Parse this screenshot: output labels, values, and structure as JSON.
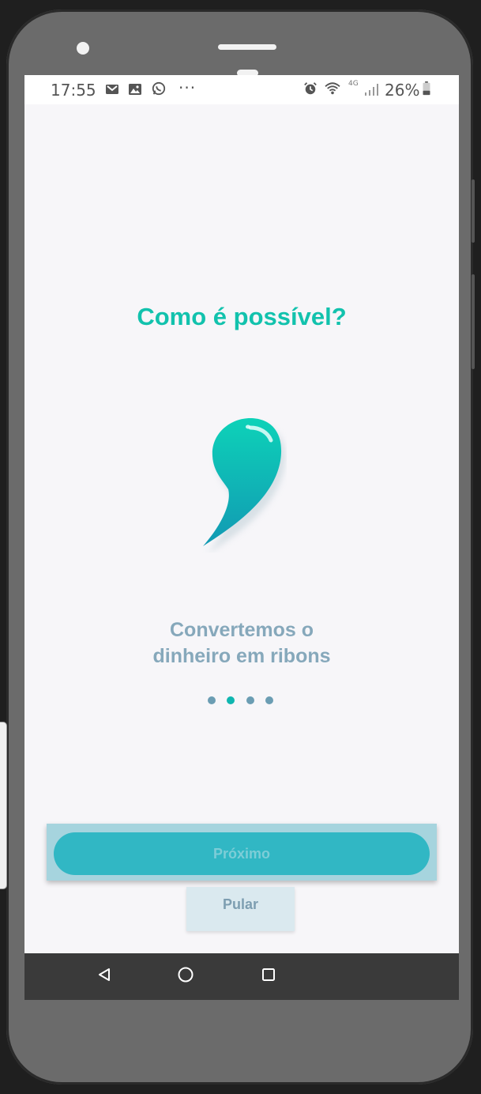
{
  "status_bar": {
    "time": "17:55",
    "notification_icons": [
      "gmail-icon",
      "gallery-icon",
      "whatsapp-icon"
    ],
    "more": "···",
    "system_icons": [
      "alarm-icon",
      "wifi-icon",
      "4g-icon",
      "signal-icon"
    ],
    "network": "4G",
    "battery": "26%"
  },
  "onboarding": {
    "title": "Como é possível?",
    "illustration": "ribon-drop-icon",
    "description_line1": "Convertemos o",
    "description_line2": "dinheiro em ribons",
    "page_count": 4,
    "current_page": 2
  },
  "actions": {
    "next_label": "Próximo",
    "skip_label": "Pular"
  },
  "navigation": [
    "back-icon",
    "home-icon",
    "recents-icon"
  ],
  "colors": {
    "accent": "#12c2ad",
    "button": "#31b7c4",
    "text_muted": "#86a8bb"
  }
}
